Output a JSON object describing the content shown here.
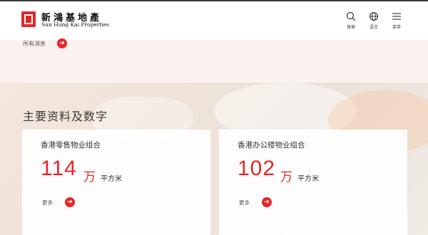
{
  "header": {
    "brand_cn": "新鴻基地產",
    "brand_en": "Sun Hung Kai Properties",
    "nav": [
      {
        "icon": "search-icon",
        "label": "搜索"
      },
      {
        "icon": "globe-icon",
        "label": "语言"
      },
      {
        "icon": "menu-icon",
        "label": "菜单"
      }
    ]
  },
  "news": {
    "link_label": "所有消息"
  },
  "key_facts": {
    "title": "主要资料及数字",
    "cards": [
      {
        "title": "香港零售物业组合",
        "number": "114",
        "unit_big": "万",
        "unit_small": "平方米",
        "more": "更多"
      },
      {
        "title": "香港办公楼物业组合",
        "number": "102",
        "unit_big": "万",
        "unit_small": "平方米",
        "more": "更多"
      }
    ]
  },
  "colors": {
    "accent": "#e52528",
    "news_bg": "#fbf2ef"
  }
}
